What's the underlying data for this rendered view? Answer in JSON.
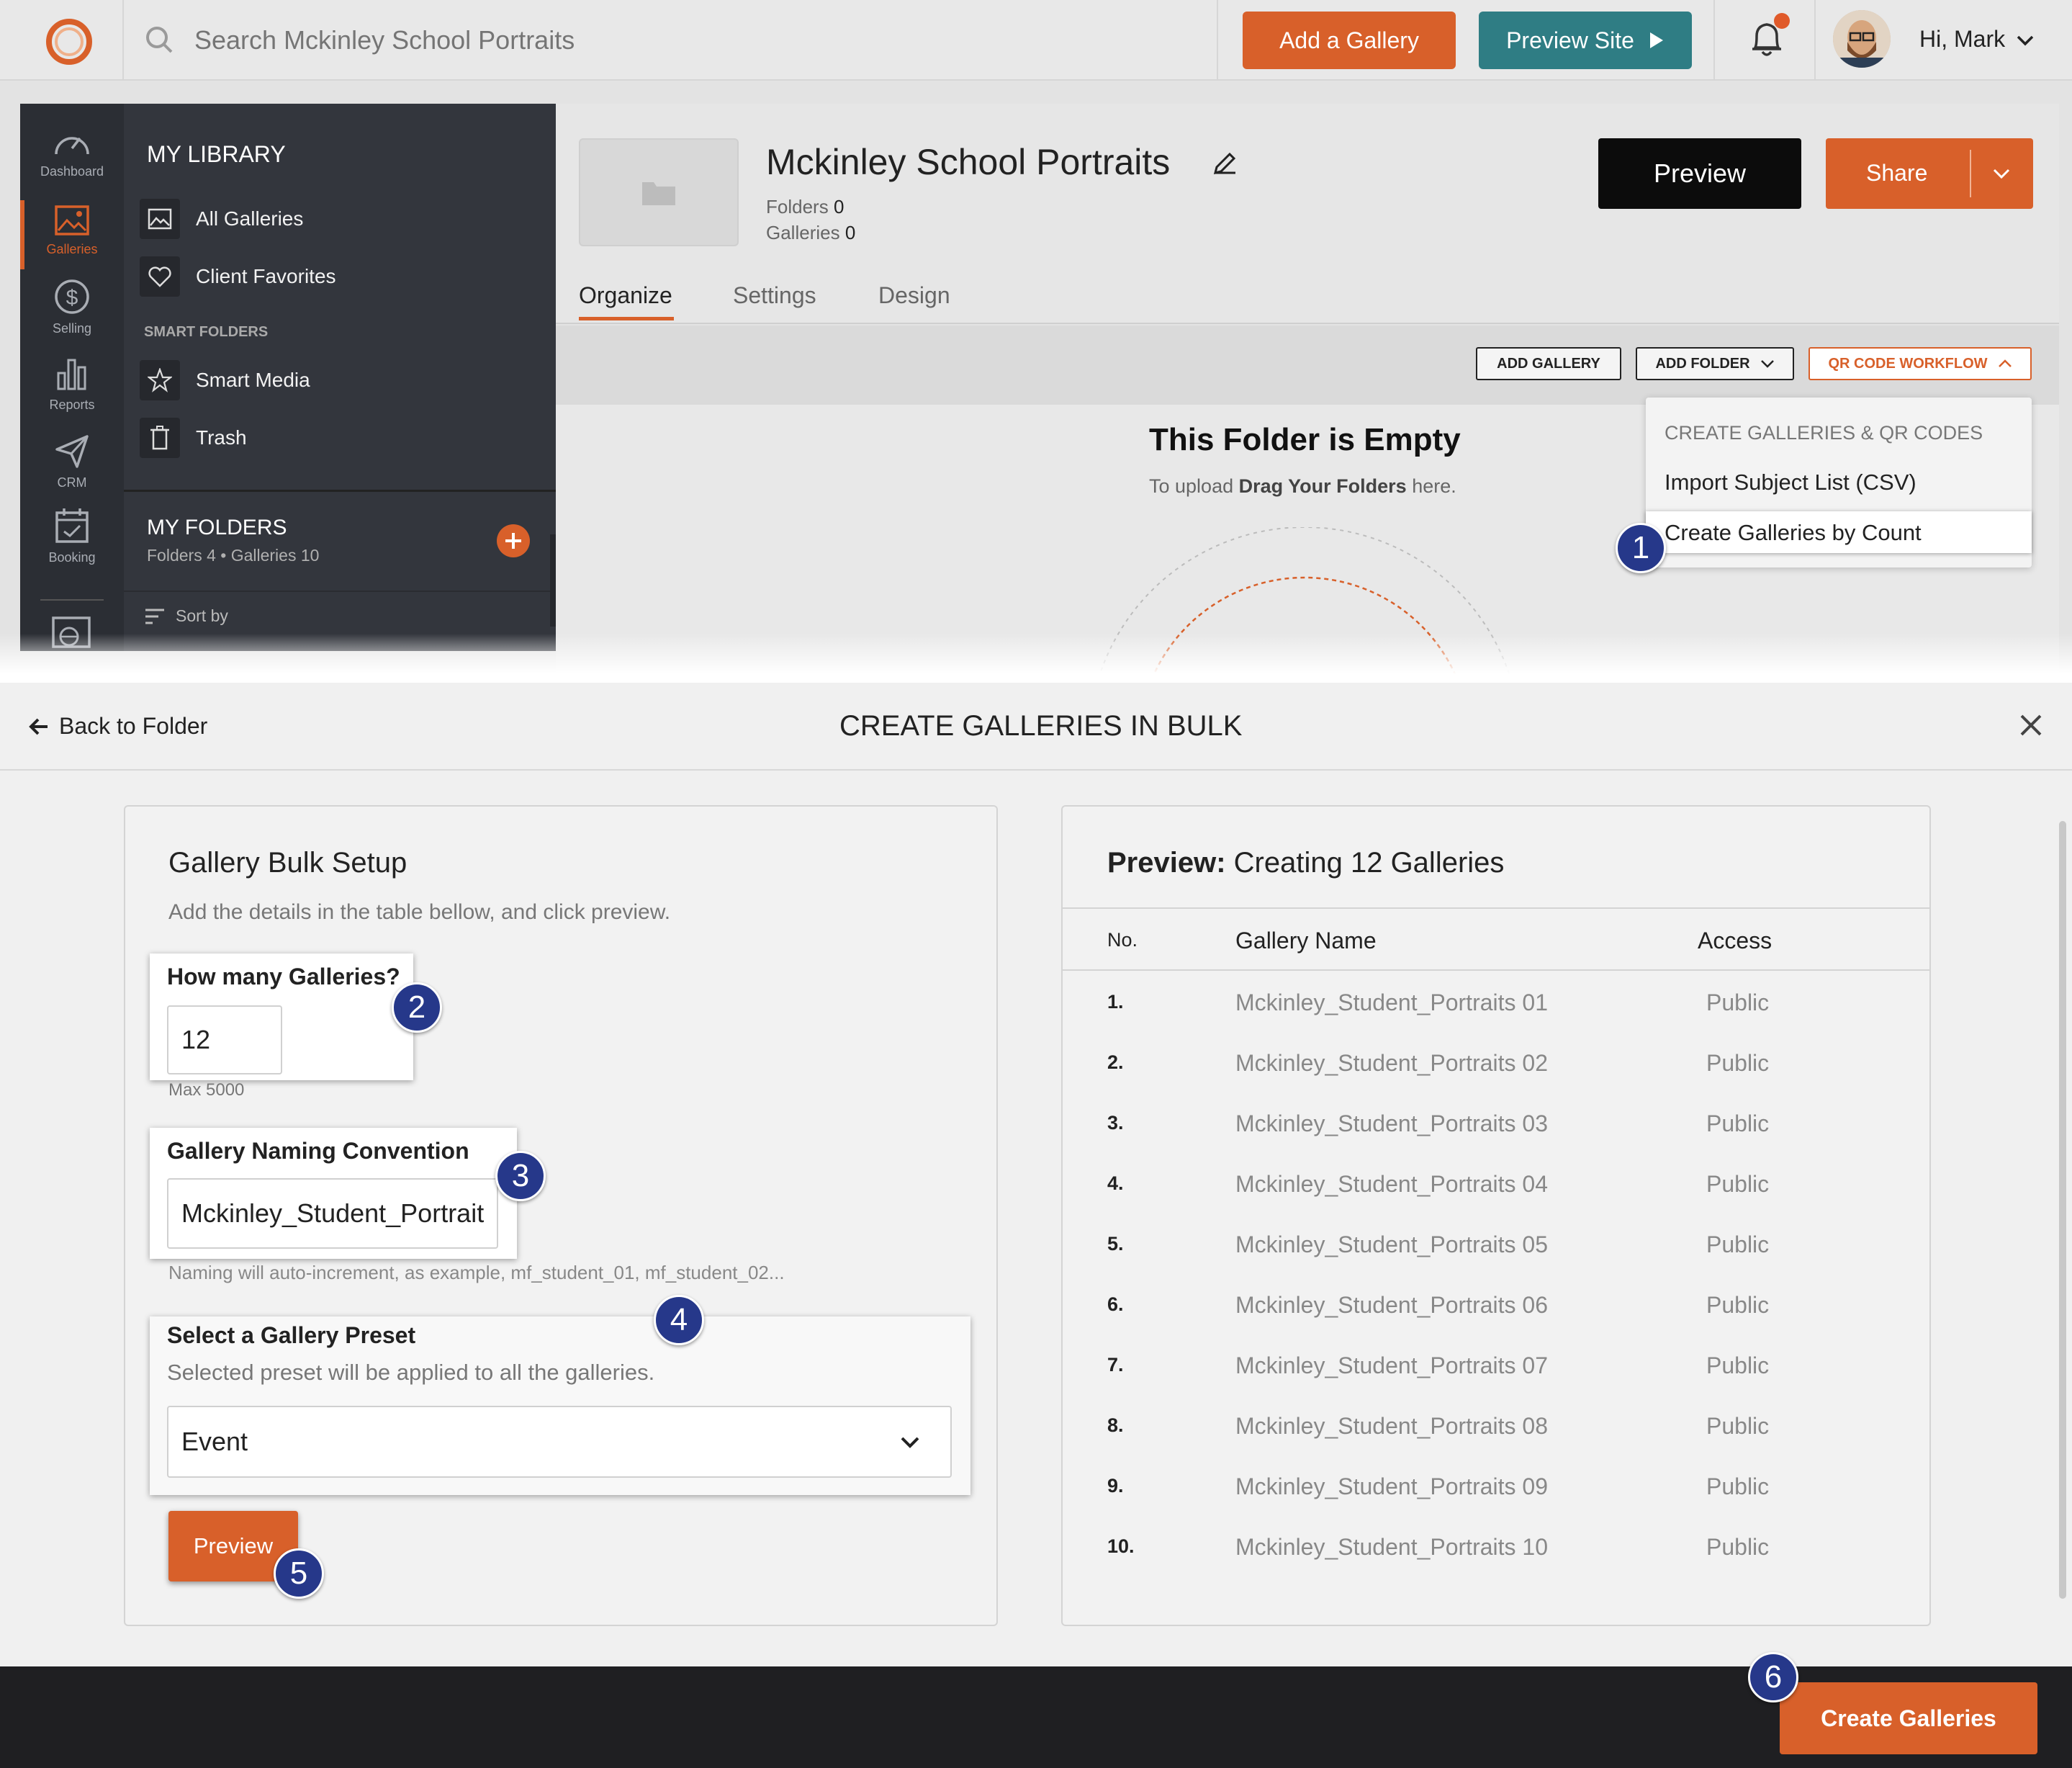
{
  "topbar": {
    "search_placeholder": "Search Mckinley School Portraits",
    "add_gallery": "Add a Gallery",
    "preview_site": "Preview Site",
    "greeting": "Hi, Mark"
  },
  "rail": {
    "items": [
      {
        "label": "Dashboard",
        "icon": "gauge-icon"
      },
      {
        "label": "Galleries",
        "icon": "image-icon",
        "active": true
      },
      {
        "label": "Selling",
        "icon": "dollar-icon"
      },
      {
        "label": "Reports",
        "icon": "bar-chart-icon"
      },
      {
        "label": "CRM",
        "icon": "paper-plane-icon"
      },
      {
        "label": "Booking",
        "icon": "calendar-icon"
      }
    ]
  },
  "library": {
    "title": "MY LIBRARY",
    "all_galleries": "All Galleries",
    "client_favorites": "Client Favorites",
    "smart_folders": "SMART FOLDERS",
    "smart_media": "Smart Media",
    "trash": "Trash",
    "my_folders": "MY FOLDERS",
    "folders_meta": "Folders 4 • Galleries 10",
    "sort_by": "Sort by"
  },
  "folder": {
    "title": "Mckinley School Portraits",
    "folders_label": "Folders",
    "folders_count": "0",
    "galleries_label": "Galleries",
    "galleries_count": "0",
    "preview": "Preview",
    "share": "Share",
    "tabs": [
      "Organize",
      "Settings",
      "Design"
    ],
    "add_gallery": "ADD GALLERY",
    "add_folder": "ADD FOLDER",
    "qr_workflow": "QR CODE WORKFLOW",
    "empty_title": "This Folder is Empty",
    "empty_sub_pre": "To upload",
    "empty_sub_bold": "Drag Your Folders",
    "empty_sub_post": "here."
  },
  "dropdown": {
    "header": "CREATE GALLERIES & QR CODES",
    "import_csv": "Import Subject List (CSV)",
    "by_count": "Create Galleries by Count"
  },
  "modal": {
    "back": "Back to Folder",
    "title": "CREATE GALLERIES IN BULK"
  },
  "setup": {
    "title": "Gallery Bulk Setup",
    "subtitle": "Add the details in the table bellow, and click preview.",
    "count_label": "How many Galleries?",
    "count_value": "12",
    "count_hint": "Max 5000",
    "naming_label": "Gallery Naming Convention",
    "naming_value": "Mckinley_Student_Portrait",
    "naming_hint": "Naming will auto-increment, as example, mf_student_01, mf_student_02...",
    "preset_label": "Select a Gallery Preset",
    "preset_hint": "Selected preset will be applied to all the galleries.",
    "preset_value": "Event",
    "preview_button": "Preview"
  },
  "preview": {
    "title_bold": "Preview:",
    "title_rest": "Creating 12 Galleries",
    "columns": [
      "No.",
      "Gallery Name",
      "Access"
    ],
    "rows": [
      {
        "no": "1.",
        "name": "Mckinley_Student_Portraits 01",
        "access": "Public"
      },
      {
        "no": "2.",
        "name": "Mckinley_Student_Portraits 02",
        "access": "Public"
      },
      {
        "no": "3.",
        "name": "Mckinley_Student_Portraits 03",
        "access": "Public"
      },
      {
        "no": "4.",
        "name": "Mckinley_Student_Portraits 04",
        "access": "Public"
      },
      {
        "no": "5.",
        "name": "Mckinley_Student_Portraits 05",
        "access": "Public"
      },
      {
        "no": "6.",
        "name": "Mckinley_Student_Portraits 06",
        "access": "Public"
      },
      {
        "no": "7.",
        "name": "Mckinley_Student_Portraits 07",
        "access": "Public"
      },
      {
        "no": "8.",
        "name": "Mckinley_Student_Portraits 08",
        "access": "Public"
      },
      {
        "no": "9.",
        "name": "Mckinley_Student_Portraits 09",
        "access": "Public"
      },
      {
        "no": "10.",
        "name": "Mckinley_Student_Portraits 10",
        "access": "Public"
      }
    ]
  },
  "footer": {
    "create": "Create Galleries"
  },
  "badges": [
    "1",
    "2",
    "3",
    "4",
    "5",
    "6"
  ],
  "colors": {
    "accent": "#d8602a",
    "teal": "#2f7d84",
    "badge": "#26388a",
    "sidebar": "#33363d"
  }
}
